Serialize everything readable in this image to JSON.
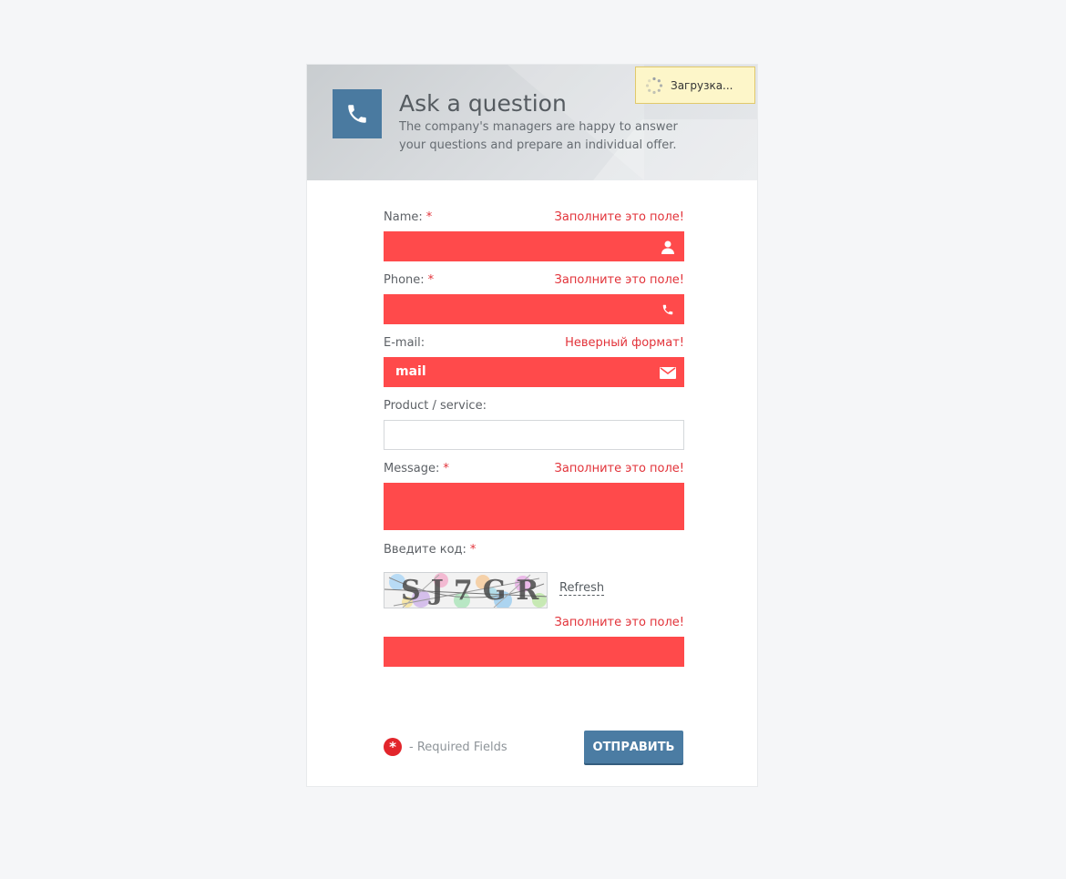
{
  "header": {
    "title": "Ask a question",
    "subtitle": "The company's managers are happy to answer your questions and prepare an individual offer.",
    "icon": "phone-icon"
  },
  "loading": {
    "text": "Загрузка..."
  },
  "form": {
    "required_mark": "*",
    "name": {
      "label": "Name:",
      "error": "Заполните это поле!",
      "value": "",
      "icon": "user-icon"
    },
    "phone": {
      "label": "Phone:",
      "error": "Заполните это поле!",
      "value": "",
      "icon": "phone-icon"
    },
    "email": {
      "label": "E-mail:",
      "error": "Неверный формат!",
      "value": "mail",
      "icon": "envelope-icon"
    },
    "product": {
      "label": "Product / service:",
      "value": ""
    },
    "message": {
      "label": "Message:",
      "error": "Заполните это поле!",
      "value": ""
    },
    "captcha": {
      "label": "Введите код:",
      "code_text": "SJ7GR",
      "refresh_label": "Refresh",
      "error": "Заполните это поле!",
      "value": ""
    }
  },
  "footer": {
    "required_note": "- Required Fields",
    "submit_label": "ОТПРАВИТЬ"
  },
  "colors": {
    "error_field": "#ff4a4b",
    "error_text": "#e2333a",
    "accent": "#4b7ca3",
    "background": "#f5f6f8"
  }
}
